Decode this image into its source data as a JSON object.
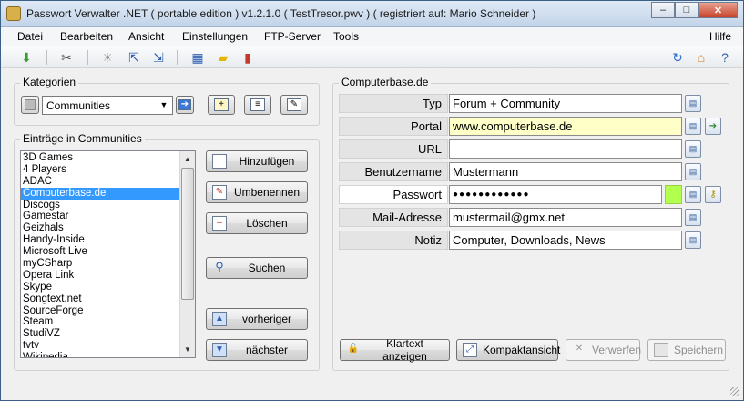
{
  "window": {
    "title": "Passwort Verwalter .NET ( portable edition )  v1.2.1.0  ( TestTresor.pwv )  ( registriert auf: Mario Schneider )",
    "buttons": {
      "minimize": "–",
      "maximize": "□",
      "close": "✕"
    }
  },
  "menu": {
    "items": [
      {
        "label": "Datei"
      },
      {
        "label": "Bearbeiten"
      },
      {
        "label": "Ansicht"
      },
      {
        "label": "Einstellungen"
      },
      {
        "label": "FTP-Server"
      },
      {
        "label": "Tools"
      }
    ],
    "help": "Hilfe"
  },
  "toolbar": {
    "icons": [
      "download-icon",
      "tools-icon",
      "bulb-icon",
      "export-icon",
      "import-icon",
      "table-icon",
      "note-icon",
      "chart-icon",
      "refresh-icon",
      "home-icon",
      "help-icon"
    ]
  },
  "categories": {
    "group_label": "Kategorien",
    "selected": "Communities"
  },
  "entries": {
    "group_label": "Einträge in Communities",
    "items": [
      "3D Games",
      "4 Players",
      "ADAC",
      "Computerbase.de",
      "Discogs",
      "Gamestar",
      "Geizhals",
      "Handy-Inside",
      "Microsoft Live",
      "myCSharp",
      "Opera Link",
      "Skype",
      "Songtext.net",
      "SourceForge",
      "Steam",
      "StudiVZ",
      "tvtv",
      "Wikipedia"
    ],
    "selected_index": 3,
    "buttons": {
      "add": "Hinzufügen",
      "rename": "Umbenennen",
      "delete": "Löschen",
      "search": "Suchen",
      "previous": "vorheriger",
      "next": "nächster"
    }
  },
  "detail": {
    "group_label": "Computerbase.de",
    "fields": {
      "typ": {
        "label": "Typ",
        "value": "Forum + Community"
      },
      "portal": {
        "label": "Portal",
        "value": "www.computerbase.de"
      },
      "url": {
        "label": "URL",
        "value": ""
      },
      "user": {
        "label": "Benutzername",
        "value": "Mustermann"
      },
      "password": {
        "label": "Passwort",
        "value": "●●●●●●●●●●●●"
      },
      "mail": {
        "label": "Mail-Adresse",
        "value": "mustermail@gmx.net"
      },
      "note": {
        "label": "Notiz",
        "value": "Computer, Downloads, News"
      }
    },
    "buttons": {
      "cleartext": "Klartext anzeigen",
      "compact": "Kompaktansicht",
      "discard": "Verwerfen",
      "save": "Speichern"
    }
  },
  "colors": {
    "portal_field_bg": "#ffffc8",
    "password_strength": "#b2ff4d",
    "selection": "#3399ff"
  }
}
